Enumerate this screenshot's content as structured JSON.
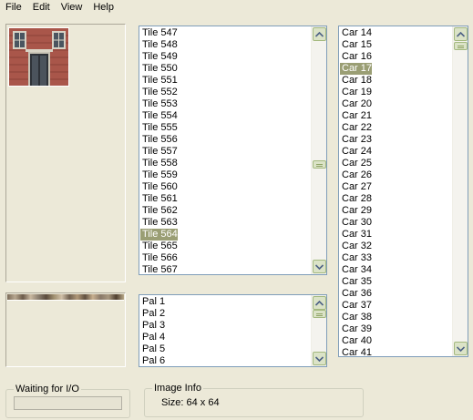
{
  "menu": [
    "File",
    "Edit",
    "View",
    "Help"
  ],
  "tiles": {
    "items": [
      "Tile 547",
      "Tile 548",
      "Tile 549",
      "Tile 550",
      "Tile 551",
      "Tile 552",
      "Tile 553",
      "Tile 554",
      "Tile 555",
      "Tile 556",
      "Tile 557",
      "Tile 558",
      "Tile 559",
      "Tile 560",
      "Tile 561",
      "Tile 562",
      "Tile 563",
      "Tile 564",
      "Tile 565",
      "Tile 566",
      "Tile 567"
    ],
    "selected": "Tile 564"
  },
  "cars": {
    "items": [
      "Car 14",
      "Car 15",
      "Car 16",
      "Car 17",
      "Car 18",
      "Car 19",
      "Car 20",
      "Car 21",
      "Car 22",
      "Car 23",
      "Car 24",
      "Car 25",
      "Car 26",
      "Car 27",
      "Car 28",
      "Car 29",
      "Car 30",
      "Car 31",
      "Car 32",
      "Car 33",
      "Car 34",
      "Car 35",
      "Car 36",
      "Car 37",
      "Car 38",
      "Car 39",
      "Car 40",
      "Car 41"
    ],
    "selected": "Car 17"
  },
  "palettes": {
    "items": [
      "Pal 1",
      "Pal 2",
      "Pal 3",
      "Pal 4",
      "Pal 5",
      "Pal 6"
    ]
  },
  "status": {
    "title": "Waiting for I/O"
  },
  "image_info": {
    "title": "Image Info",
    "size": "Size: 64 x 64"
  },
  "colors": {
    "background": "#ece9d8",
    "selection": "#9a9e74",
    "list_border": "#7f9db9",
    "scroll_button": "#dbe3c7"
  },
  "icons": [
    "arrow-up-icon",
    "arrow-down-icon"
  ]
}
